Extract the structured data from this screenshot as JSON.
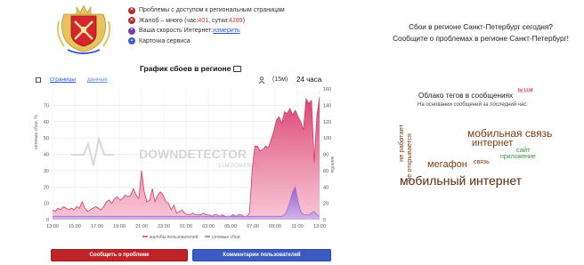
{
  "header": {
    "coat_of_arms": "saint-petersburg-coat-of-arms"
  },
  "info": {
    "row1": "Проблемы с доступом к региональным страницам",
    "row2_prefix": "Жалоб – много (час: ",
    "row2_hour": "401",
    "row2_mid": ", сутки: ",
    "row2_day": "4289",
    "row2_suffix": ")",
    "row3_prefix": "Ваша скорость Интернет: ",
    "row3_link": "измерить",
    "row4": "Карточка сервиса"
  },
  "headline": {
    "line1": "Сбои в регионе Санкт-Петербург сегодня?",
    "line2": "Сообщите о проблемах в регионе Санкт-Петербург!"
  },
  "chart": {
    "title": "График сбоев в регионе",
    "tab_pages": "страницы",
    "tab_data": "данные",
    "range_15m": "(15м)",
    "range_24h": "24 часа",
    "watermark": "DOWNDETECTOR",
    "watermark_sub": "LLM POWERED",
    "y_left_label": "сетевые сбои, %",
    "y_right_label": "жалобы",
    "legend_complaints": "жалобы пользователей",
    "legend_network": "сетевые сбои"
  },
  "chart_data": {
    "type": "area",
    "x": [
      "13:00",
      "15:00",
      "17:00",
      "19:00",
      "21:00",
      "23:00",
      "01:00",
      "03:00",
      "05:00",
      "07:00",
      "09:00",
      "11:00",
      "13:00"
    ],
    "y_left_ticks": [
      0,
      10,
      20,
      30,
      40,
      50,
      60,
      70
    ],
    "y_right_ticks": [
      0,
      20,
      40,
      60,
      80,
      100,
      120,
      140,
      160
    ],
    "ylim_left": [
      0,
      80
    ],
    "ylim_right": [
      0,
      160
    ],
    "series": [
      {
        "name": "жалобы пользователей",
        "axis": "right",
        "color": "#d33a6a",
        "values": [
          12,
          10,
          14,
          12,
          16,
          14,
          12,
          14,
          12,
          16,
          14,
          22,
          14,
          10,
          12,
          14,
          16,
          14,
          12,
          16,
          22,
          24,
          20,
          26,
          28,
          24,
          26,
          30,
          28,
          30,
          38,
          30,
          26,
          60,
          34,
          22,
          24,
          38,
          22,
          30,
          34,
          30,
          22,
          20,
          12,
          18,
          8,
          10,
          12,
          8,
          6,
          6,
          8,
          6,
          6,
          6,
          8,
          6,
          6,
          4,
          6,
          6,
          4,
          6,
          4,
          4,
          4,
          6,
          4,
          6,
          6,
          4,
          4,
          8,
          60,
          90,
          90,
          84,
          86,
          90,
          88,
          98,
          108,
          122,
          126,
          118,
          132,
          130,
          136,
          128,
          134,
          126,
          120,
          110,
          148,
          142,
          146,
          70,
          128,
          150
        ]
      },
      {
        "name": "сетевые сбои",
        "axis": "right",
        "color": "#9b6fd0",
        "values": [
          4,
          4,
          4,
          4,
          4,
          4,
          4,
          4,
          4,
          4,
          4,
          4,
          4,
          4,
          4,
          4,
          4,
          4,
          4,
          4,
          4,
          4,
          4,
          4,
          4,
          4,
          4,
          4,
          4,
          4,
          4,
          4,
          4,
          4,
          4,
          4,
          4,
          4,
          4,
          4,
          4,
          4,
          4,
          4,
          4,
          4,
          4,
          4,
          4,
          4,
          4,
          4,
          4,
          4,
          4,
          4,
          4,
          4,
          4,
          4,
          4,
          4,
          4,
          4,
          4,
          4,
          4,
          4,
          4,
          4,
          4,
          4,
          4,
          4,
          4,
          4,
          4,
          4,
          4,
          4,
          4,
          4,
          4,
          4,
          4,
          4,
          6,
          12,
          22,
          34,
          40,
          22,
          10,
          6,
          6,
          6,
          8,
          10,
          6,
          4
        ]
      }
    ]
  },
  "buttons": {
    "report": "Сообщить о проблеме",
    "comments": "Комментарии пользователей"
  },
  "cloud": {
    "title": "Облако тегов в сообщениях",
    "badge": "by LLM",
    "subtitle": "На основании сообщений за последний час:",
    "tags": [
      {
        "text": "мобильная связь",
        "size": 12,
        "color": "#7a3b10"
      },
      {
        "text": "мобильный интернет",
        "size": 14,
        "color": "#5a2a10"
      },
      {
        "text": "интернет",
        "size": 11,
        "color": "#7a3b10"
      },
      {
        "text": "мегафон",
        "size": 11,
        "color": "#7a3b10"
      },
      {
        "text": "сайт",
        "size": 7.5,
        "color": "#3f8a3f"
      },
      {
        "text": "приложение",
        "size": 7,
        "color": "#3f8a3f"
      },
      {
        "text": "связь",
        "size": 7,
        "color": "#7a3b10"
      },
      {
        "text": "не работает",
        "size": 7.5,
        "color": "#7a3b10"
      },
      {
        "text": "не открывается",
        "size": 7.5,
        "color": "#7a3b10"
      }
    ]
  }
}
